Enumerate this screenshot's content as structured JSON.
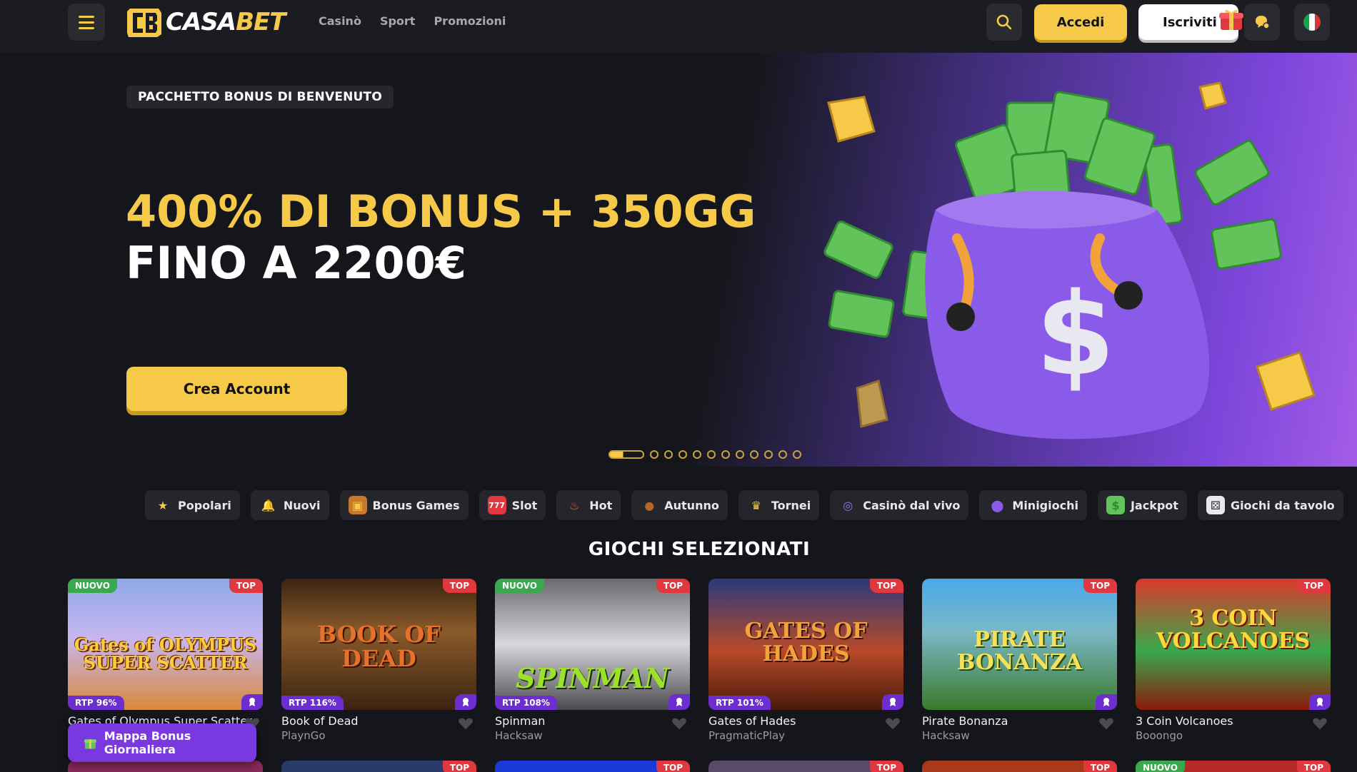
{
  "header": {
    "logo_text_a": "CASA",
    "logo_text_b": "BET",
    "nav": [
      "Casinò",
      "Sport",
      "Promozioni"
    ],
    "login_label": "Accedi",
    "signup_label": "Iscriviti"
  },
  "hero": {
    "badge": "PACCHETTO BONUS DI BENVENUTO",
    "line1": "400% DI BONUS + 350GG",
    "line2": "FINO A 2200€",
    "cta": "Crea Account",
    "slides_count": 12,
    "active_slide": 1
  },
  "categories": [
    {
      "label": "Popolari",
      "icon": "star-icon"
    },
    {
      "label": "Nuovi",
      "icon": "bell-icon"
    },
    {
      "label": "Bonus Games",
      "icon": "treasure-chest-icon"
    },
    {
      "label": "Slot",
      "icon": "slot-machine-icon"
    },
    {
      "label": "Hot",
      "icon": "fire-icon"
    },
    {
      "label": "Autunno",
      "icon": "acorn-icon"
    },
    {
      "label": "Tornei",
      "icon": "trophy-icon"
    },
    {
      "label": "Casinò dal vivo",
      "icon": "roulette-icon"
    },
    {
      "label": "Minigiochi",
      "icon": "potion-icon"
    },
    {
      "label": "Jackpot",
      "icon": "cash-icon"
    },
    {
      "label": "Giochi da tavolo",
      "icon": "dice-icon"
    }
  ],
  "section_title": "GIOCHI SELEZIONATI",
  "games": [
    {
      "name": "Gates of Olympus Super Scatter",
      "provider": "",
      "new": "NUOVO",
      "top": "TOP",
      "rtp": "RTP 96%",
      "art": "Gates of OLYMPUS SUPER SCATTER"
    },
    {
      "name": "Book of Dead",
      "provider": "PlaynGo",
      "new": "",
      "top": "TOP",
      "rtp": "RTP 116%",
      "art": "BOOK OF DEAD"
    },
    {
      "name": "Spinman",
      "provider": "Hacksaw",
      "new": "NUOVO",
      "top": "TOP",
      "rtp": "RTP 108%",
      "art": "SPINMAN"
    },
    {
      "name": "Gates of Hades",
      "provider": "PragmaticPlay",
      "new": "",
      "top": "TOP",
      "rtp": "RTP 101%",
      "art": "GATES OF HADES"
    },
    {
      "name": "Pirate Bonanza",
      "provider": "Hacksaw",
      "new": "",
      "top": "TOP",
      "rtp": "",
      "art": "PIRATE BONANZA"
    },
    {
      "name": "3 Coin Volcanoes",
      "provider": "Booongo",
      "new": "",
      "top": "TOP",
      "rtp": "",
      "art": "3 COIN VOLCANOES"
    }
  ],
  "row2_tags": [
    {
      "new": "",
      "top": ""
    },
    {
      "new": "",
      "top": "TOP"
    },
    {
      "new": "",
      "top": "TOP"
    },
    {
      "new": "",
      "top": "TOP"
    },
    {
      "new": "",
      "top": "TOP"
    },
    {
      "new": "NUOVO",
      "top": "TOP"
    }
  ],
  "bonus_map_label": "Mappa Bonus Giornaliera",
  "colors": {
    "accent": "#f7c948",
    "background": "#15161b",
    "purple": "#7a39e0",
    "tag_new": "#3aa84c",
    "tag_top": "#e0383e"
  }
}
